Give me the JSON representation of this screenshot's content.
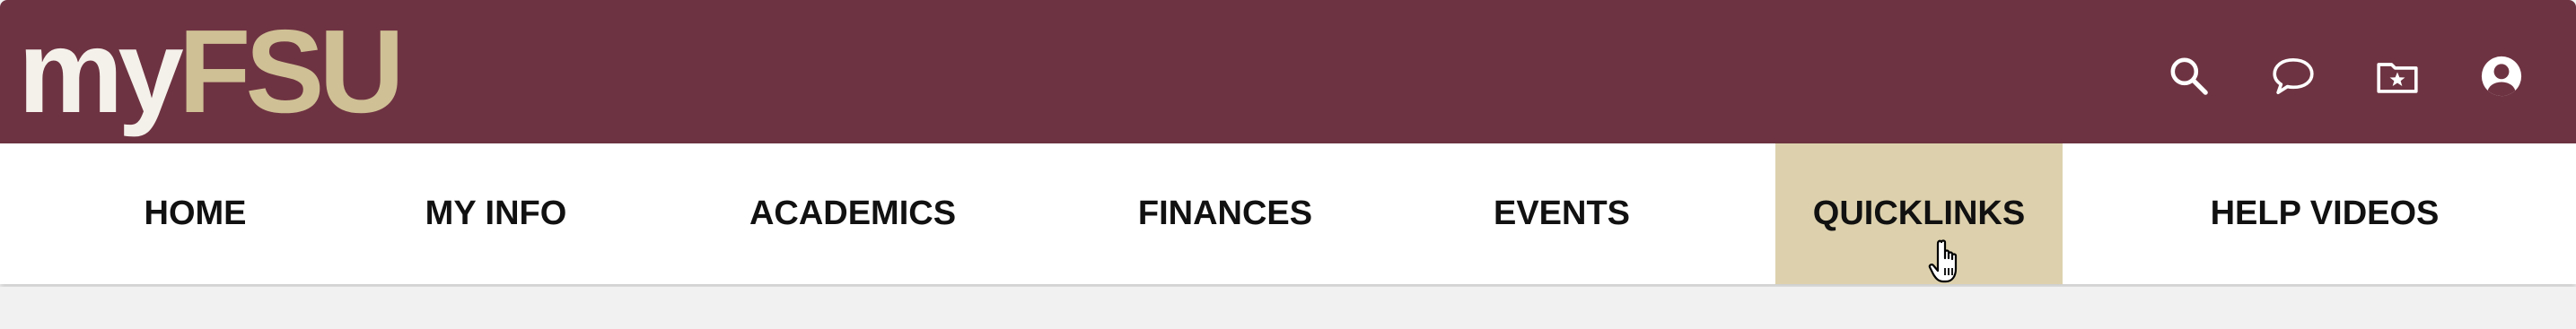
{
  "header": {
    "logo": {
      "part1": "my",
      "part2": "FSU"
    },
    "icons": [
      {
        "name": "search-icon"
      },
      {
        "name": "chat-icon"
      },
      {
        "name": "favorites-folder-icon"
      },
      {
        "name": "account-icon"
      }
    ]
  },
  "nav": {
    "items": [
      {
        "label": "HOME",
        "active": false
      },
      {
        "label": "MY INFO",
        "active": false
      },
      {
        "label": "ACADEMICS",
        "active": false
      },
      {
        "label": "FINANCES",
        "active": false
      },
      {
        "label": "EVENTS",
        "active": false
      },
      {
        "label": "QUICKLINKS",
        "active": true
      },
      {
        "label": "HELP VIDEOS",
        "active": false
      }
    ]
  },
  "colors": {
    "header_bg": "#6e3342",
    "logo_gold": "#cfc095",
    "active_tab_bg": "#ddd1ad"
  }
}
